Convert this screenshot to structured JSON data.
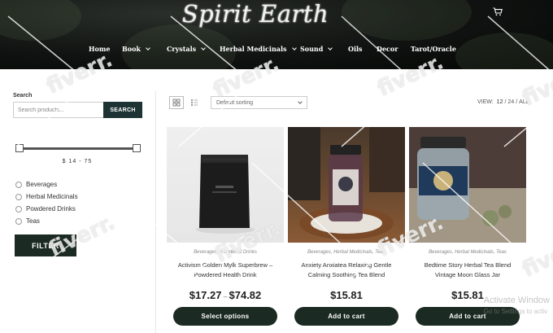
{
  "header": {
    "logo": "Spirit Earth",
    "nav": [
      {
        "label": "Home",
        "dropdown": false
      },
      {
        "label": "Book",
        "dropdown": true
      },
      {
        "label": "Crystals",
        "dropdown": true
      },
      {
        "label": "Herbal Medicinals",
        "dropdown": true
      },
      {
        "label": "Sound",
        "dropdown": true
      },
      {
        "label": "Oils",
        "dropdown": false
      },
      {
        "label": "Decor",
        "dropdown": false
      },
      {
        "label": "Tarot/Oracle",
        "dropdown": false
      }
    ],
    "cart_icon": "cart-icon"
  },
  "sidebar": {
    "search_title": "Search",
    "search_placeholder": "Search products...",
    "search_button": "SEARCH",
    "price_min": 14,
    "price_max": 75,
    "price_range_text": "$ 14 - 75",
    "categories": [
      "Beverages",
      "Herbal Medicinals",
      "Powdered Drinks",
      "Teas"
    ],
    "filter_button": "FILTER"
  },
  "toolbar": {
    "sort_label": "Default sorting",
    "view_label": "VIEW:",
    "view_options": [
      "12",
      "24",
      "ALL"
    ],
    "view_separator": "/"
  },
  "products": [
    {
      "categories": "Beverages, Powdered Drinks",
      "title": "Activism Golden Mylk Superbrew – Powdered Health Drink",
      "price_low": "$17.27",
      "price_sep": "–",
      "price_high": "$74.82",
      "button": "Select options"
    },
    {
      "categories": "Beverages, Herbal Medicinals, Teas",
      "title": "Anxiety Anxiatea Relaxing Gentle Calming Soothing Tea Blend",
      "price": "$15.81",
      "button": "Add to cart"
    },
    {
      "categories": "Beverages, Herbal Medicinals, Teas",
      "title": "Bedtime Story Herbal Tea Blend Vintage Moon Glass Jar",
      "price": "$15.81",
      "button": "Add to cart"
    }
  ],
  "watermark": {
    "line1": "Activate Window",
    "line2": "Go to Settings to activ"
  },
  "fiverr": "fiverr."
}
